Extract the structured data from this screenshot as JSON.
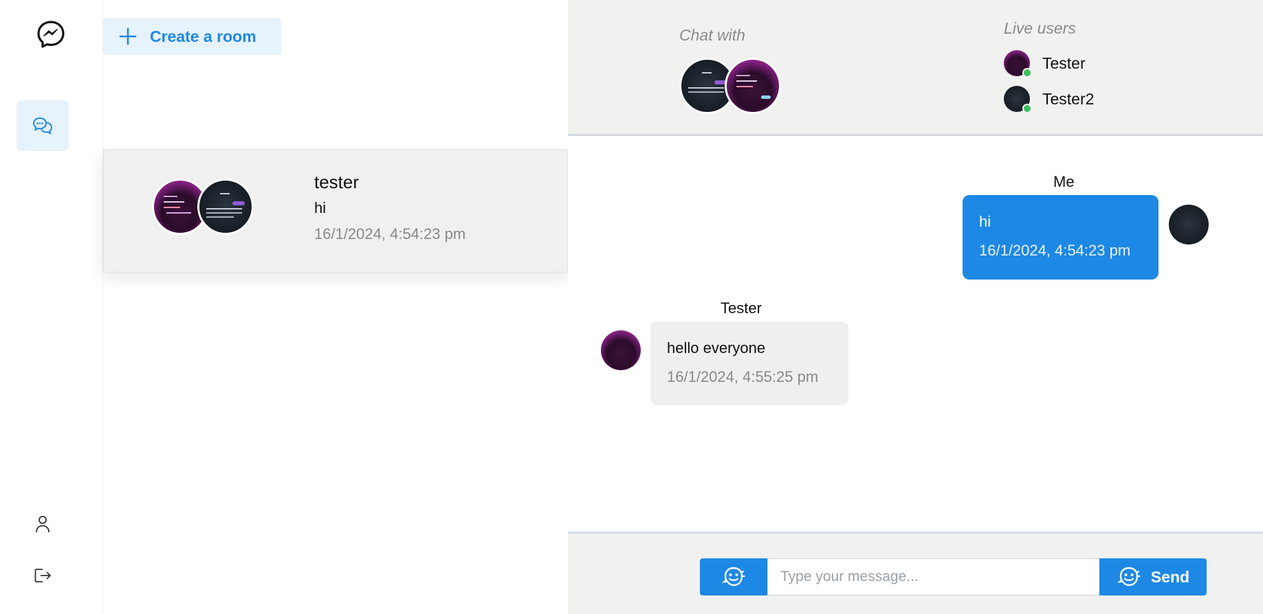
{
  "sidebar": {
    "logo_icon": "messenger-logo-icon",
    "nav": [
      {
        "id": "chats",
        "icon": "chat-bubbles-icon",
        "active": true
      },
      {
        "id": "profile",
        "icon": "user-icon"
      },
      {
        "id": "logout",
        "icon": "logout-icon"
      }
    ]
  },
  "rooms": {
    "create_label": "Create a room",
    "list": [
      {
        "name": "tester",
        "last_message": "hi",
        "time": "16/1/2024, 4:54:23 pm"
      }
    ]
  },
  "chat": {
    "chat_with_label": "Chat with",
    "live_users_label": "Live users",
    "live_users": [
      {
        "name": "Tester",
        "status": "online"
      },
      {
        "name": "Tester2",
        "status": "online"
      }
    ],
    "messages": [
      {
        "sender": "Me",
        "text": "hi",
        "time": "16/1/2024, 4:54:23 pm",
        "own": true
      },
      {
        "sender": "Tester",
        "text": "hello everyone",
        "time": "16/1/2024, 4:55:25 pm",
        "own": false
      }
    ],
    "composer": {
      "placeholder": "Type your message...",
      "send_label": "Send",
      "emoji_icon": "emoji-icon"
    }
  },
  "colors": {
    "accent": "#1e88e5",
    "accent_light": "#e6f2fc",
    "online": "#3cc15b",
    "panel_gray": "#f1f1f0"
  }
}
